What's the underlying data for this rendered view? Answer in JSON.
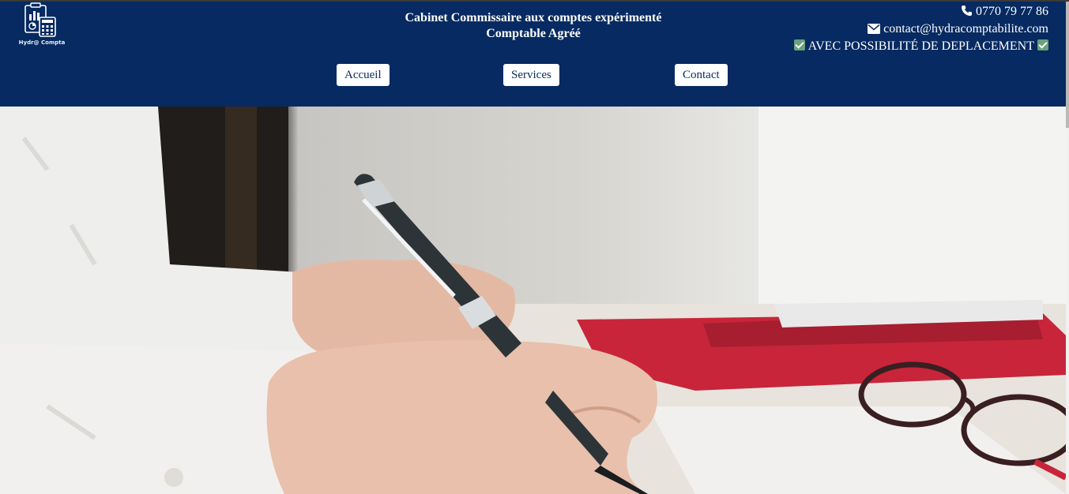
{
  "logo": {
    "text": "Hydr@ Compta",
    "icon": "clipboard-calculator-icon"
  },
  "header": {
    "title_line1": "Cabinet Commissaire aux comptes expérimenté",
    "title_line2": "Comptable Agréé"
  },
  "contact": {
    "phone": "0770 79 77 86",
    "email": "contact@hydracomptabilite.com",
    "travel": "AVEC POSSIBILITÉ DE DEPLACEMENT"
  },
  "nav": {
    "items": [
      {
        "label": "Accueil"
      },
      {
        "label": "Services"
      },
      {
        "label": "Contact"
      }
    ]
  },
  "hero": {
    "image": "hand-writing-with-pen-photo"
  },
  "colors": {
    "header_bg": "#062a61",
    "check_green": "#6aa07b",
    "nav_text": "#0b2a5b"
  }
}
